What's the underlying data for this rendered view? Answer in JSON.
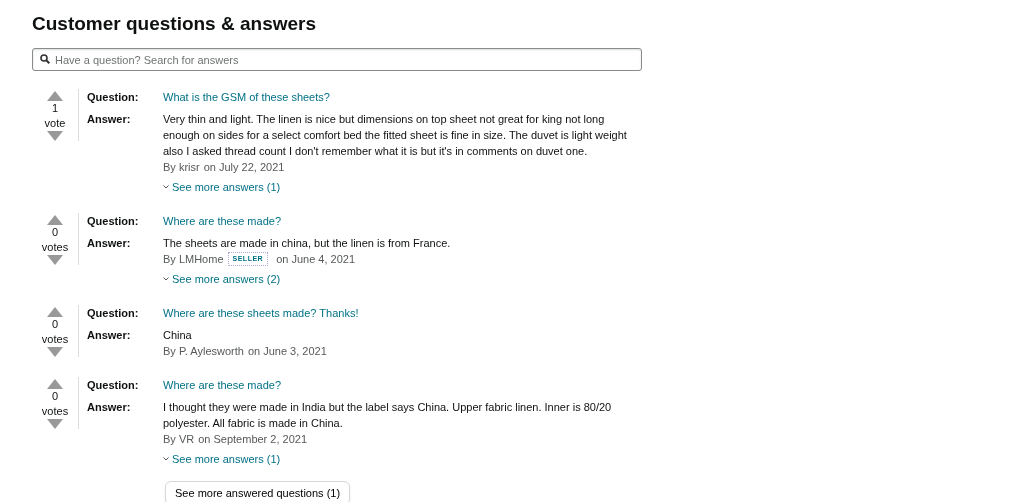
{
  "title": "Customer questions & answers",
  "search": {
    "placeholder": "Have a question? Search for answers"
  },
  "questions": [
    {
      "votes": "1",
      "vote_label": "vote",
      "question_label": "Question:",
      "question": "What is the GSM of these sheets?",
      "answer_label": "Answer:",
      "answer": "Very thin and light. The linen is nice but dimensions on top sheet not great for king not long enough on sides for a select comfort bed the fitted sheet is fine in size. The duvet is light weight also I asked thread count I don't remember what it is but it's in comments on duvet one.",
      "author": "By krisr",
      "date": "on July 22, 2021",
      "more": "See more answers (1)"
    },
    {
      "votes": "0",
      "vote_label": "votes",
      "question_label": "Question:",
      "question": "Where are these made?",
      "answer_label": "Answer:",
      "answer": "The sheets are made in china, but the linen is from France.",
      "author": "By LMHome",
      "badge": "SELLER",
      "date": "on June 4, 2021",
      "more": "See more answers (2)"
    },
    {
      "votes": "0",
      "vote_label": "votes",
      "question_label": "Question:",
      "question": "Where are these sheets made? Thanks!",
      "answer_label": "Answer:",
      "answer": "China",
      "author": "By P. Aylesworth",
      "date": "on June 3, 2021"
    },
    {
      "votes": "0",
      "vote_label": "votes",
      "question_label": "Question:",
      "question": "Where are these made?",
      "answer_label": "Answer:",
      "answer": "I thought they were made in India but the label says China. Upper fabric linen. Inner is 80/20 polyester. All fabric is made in China.",
      "author": "By VR",
      "date": "on September 2, 2021",
      "more": "See more answers (1)"
    }
  ],
  "more_button": "See more answered questions (1)"
}
